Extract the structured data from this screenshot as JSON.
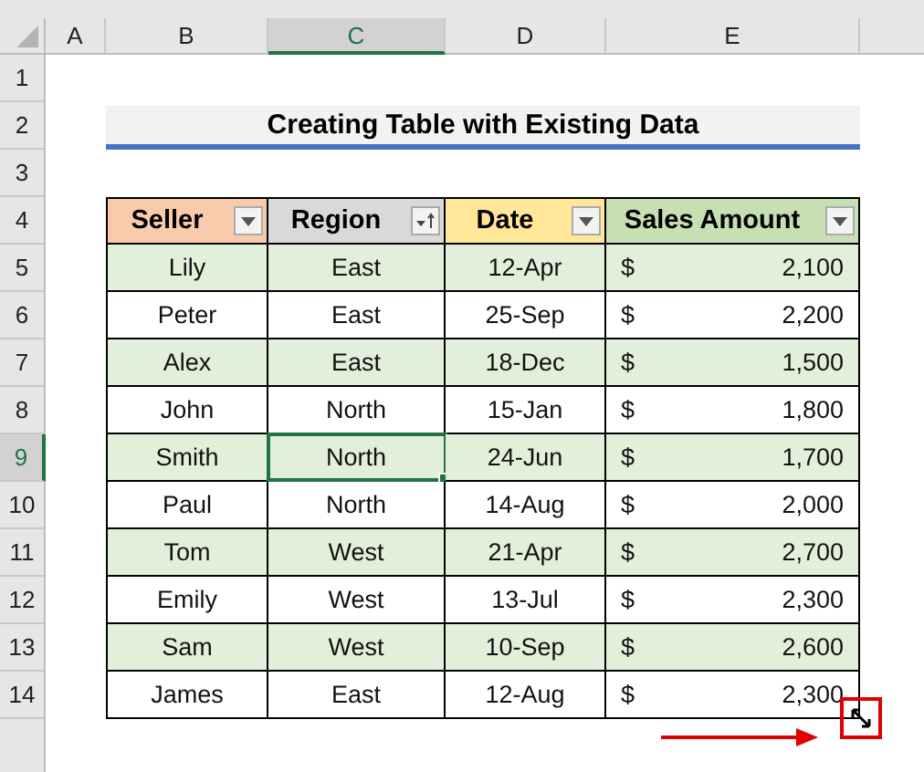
{
  "columns": [
    {
      "label": "A",
      "selected": false
    },
    {
      "label": "B",
      "selected": false
    },
    {
      "label": "C",
      "selected": true
    },
    {
      "label": "D",
      "selected": false
    },
    {
      "label": "E",
      "selected": false
    }
  ],
  "row_numbers": [
    {
      "label": "1",
      "selected": false
    },
    {
      "label": "2",
      "selected": false
    },
    {
      "label": "3",
      "selected": false
    },
    {
      "label": "4",
      "selected": false
    },
    {
      "label": "5",
      "selected": false
    },
    {
      "label": "6",
      "selected": false
    },
    {
      "label": "7",
      "selected": false
    },
    {
      "label": "8",
      "selected": false
    },
    {
      "label": "9",
      "selected": true
    },
    {
      "label": "10",
      "selected": false
    },
    {
      "label": "11",
      "selected": false
    },
    {
      "label": "12",
      "selected": false
    },
    {
      "label": "13",
      "selected": false
    },
    {
      "label": "14",
      "selected": false
    }
  ],
  "title": "Creating Table with Existing Data",
  "table": {
    "headers": [
      {
        "label": "Seller",
        "color": "#f8cbad",
        "kind": "filter"
      },
      {
        "label": "Region",
        "color": "#d9d9d9",
        "kind": "sort"
      },
      {
        "label": "Date",
        "color": "#ffe699",
        "kind": "filter"
      },
      {
        "label": "Sales Amount",
        "color": "#c6e0b4",
        "kind": "filter"
      }
    ],
    "rows": [
      {
        "seller": "Lily",
        "region": "East",
        "date": "12-Apr",
        "currency": "$",
        "amount": "2,100",
        "selected_cell": false
      },
      {
        "seller": "Peter",
        "region": "East",
        "date": "25-Sep",
        "currency": "$",
        "amount": "2,200",
        "selected_cell": false
      },
      {
        "seller": "Alex",
        "region": "East",
        "date": "18-Dec",
        "currency": "$",
        "amount": "1,500",
        "selected_cell": false
      },
      {
        "seller": "John",
        "region": "North",
        "date": "15-Jan",
        "currency": "$",
        "amount": "1,800",
        "selected_cell": false
      },
      {
        "seller": "Smith",
        "region": "North",
        "date": "24-Jun",
        "currency": "$",
        "amount": "1,700",
        "selected_cell": true
      },
      {
        "seller": "Paul",
        "region": "North",
        "date": "14-Aug",
        "currency": "$",
        "amount": "2,000",
        "selected_cell": false
      },
      {
        "seller": "Tom",
        "region": "West",
        "date": "21-Apr",
        "currency": "$",
        "amount": "2,700",
        "selected_cell": false
      },
      {
        "seller": "Emily",
        "region": "West",
        "date": "13-Jul",
        "currency": "$",
        "amount": "2,300",
        "selected_cell": false
      },
      {
        "seller": "Sam",
        "region": "West",
        "date": "10-Sep",
        "currency": "$",
        "amount": "2,600",
        "selected_cell": false
      },
      {
        "seller": "James",
        "region": "East",
        "date": "12-Aug",
        "currency": "$",
        "amount": "2,300",
        "selected_cell": false
      }
    ]
  }
}
